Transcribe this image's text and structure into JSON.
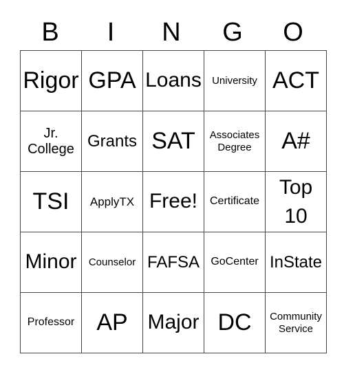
{
  "header": {
    "letters": [
      "B",
      "I",
      "N",
      "G",
      "O"
    ]
  },
  "grid": {
    "rows": [
      [
        "Rigor",
        "GPA",
        "Loans",
        "University",
        "ACT"
      ],
      [
        "Jr.\nCollege",
        "Grants",
        "SAT",
        "Associates\nDegree",
        "A#"
      ],
      [
        "TSI",
        "ApplyTX",
        "Free!",
        "Certificate",
        "Top\n10"
      ],
      [
        "Minor",
        "Counselor",
        "FAFSA",
        "GoCenter",
        "InState"
      ],
      [
        "Professor",
        "AP",
        "Major",
        "DC",
        "Community\nService"
      ]
    ]
  },
  "colors": {
    "border": "#444444",
    "text": "#000000",
    "background": "#ffffff"
  }
}
